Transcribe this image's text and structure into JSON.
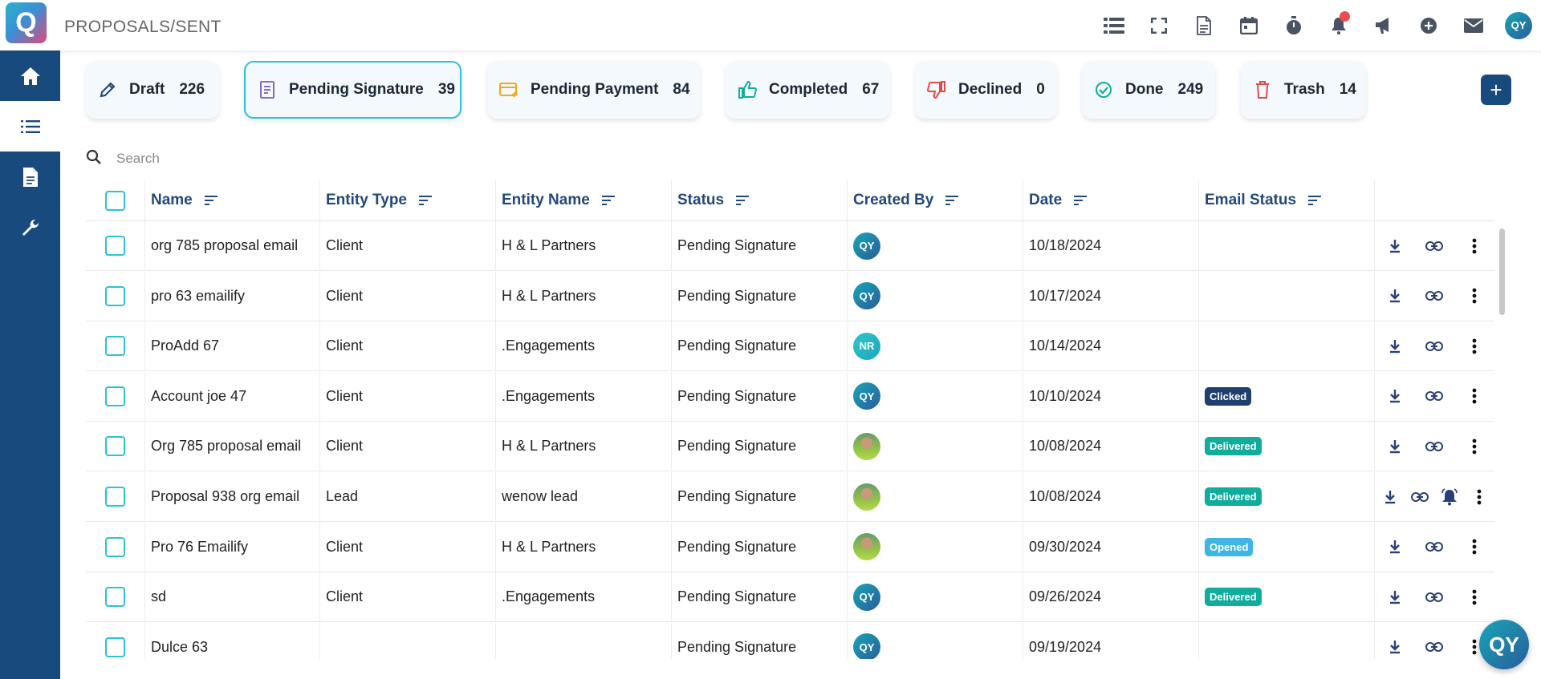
{
  "app": {
    "logo_letter": "Q",
    "page_title": "PROPOSALS/SENT"
  },
  "topbar": {
    "icons": [
      "list-view-icon",
      "fullscreen-icon",
      "document-icon",
      "calendar-icon",
      "timer-icon",
      "bell-icon",
      "megaphone-icon",
      "add-circle-icon",
      "mail-icon"
    ],
    "user_initials": "QY"
  },
  "sidebar": {
    "items": [
      {
        "name": "home",
        "icon": "home-icon",
        "active": false
      },
      {
        "name": "list",
        "icon": "list-icon",
        "active": true
      },
      {
        "name": "document",
        "icon": "document-icon",
        "active": false
      },
      {
        "name": "tools",
        "icon": "wrench-icon",
        "active": false
      }
    ]
  },
  "tabs": [
    {
      "label": "Draft",
      "count": "226",
      "icon": "pencil-icon",
      "color": "#1f3f6e"
    },
    {
      "label": "Pending Signature",
      "count": "39",
      "icon": "document-icon",
      "color": "#7b5bbd",
      "active": true
    },
    {
      "label": "Pending Payment",
      "count": "84",
      "icon": "credit-card-icon",
      "color": "#f2a81d"
    },
    {
      "label": "Completed",
      "count": "67",
      "icon": "thumbs-up-icon",
      "color": "#11ad9c"
    },
    {
      "label": "Declined",
      "count": "0",
      "icon": "thumbs-down-icon",
      "color": "#e24a4a"
    },
    {
      "label": "Done",
      "count": "249",
      "icon": "check-circle-icon",
      "color": "#11ad9c"
    },
    {
      "label": "Trash",
      "count": "14",
      "icon": "trash-icon",
      "color": "#e24a4a"
    }
  ],
  "add_button_label": "+",
  "search": {
    "placeholder": "Search"
  },
  "table": {
    "headers": [
      "Name",
      "Entity Type",
      "Entity Name",
      "Status",
      "Created By",
      "Date",
      "Email Status"
    ],
    "rows": [
      {
        "name": "org 785 proposal email",
        "entity_type": "Client",
        "entity_name": "H & L Partners",
        "status": "Pending Signature",
        "created_by": "QY",
        "avatar": "initials",
        "date": "10/18/2024",
        "email_status": "",
        "bell": false
      },
      {
        "name": "pro 63 emailify",
        "entity_type": "Client",
        "entity_name": "H & L Partners",
        "status": "Pending Signature",
        "created_by": "QY",
        "avatar": "initials",
        "date": "10/17/2024",
        "email_status": "",
        "bell": false
      },
      {
        "name": "ProAdd 67",
        "entity_type": "Client",
        "entity_name": ".Engagements",
        "status": "Pending Signature",
        "created_by": "NR",
        "avatar": "nr",
        "date": "10/14/2024",
        "email_status": "",
        "bell": false
      },
      {
        "name": "Account joe 47",
        "entity_type": "Client",
        "entity_name": ".Engagements",
        "status": "Pending Signature",
        "created_by": "QY",
        "avatar": "initials",
        "date": "10/10/2024",
        "email_status": "Clicked",
        "bell": false
      },
      {
        "name": "Org 785 proposal email",
        "entity_type": "Client",
        "entity_name": "H & L Partners",
        "status": "Pending Signature",
        "created_by": "",
        "avatar": "photo",
        "date": "10/08/2024",
        "email_status": "Delivered",
        "bell": false
      },
      {
        "name": "Proposal 938 org email",
        "entity_type": "Lead",
        "entity_name": "wenow lead",
        "status": "Pending Signature",
        "created_by": "",
        "avatar": "photo",
        "date": "10/08/2024",
        "email_status": "Delivered",
        "bell": true
      },
      {
        "name": "Pro 76 Emailify",
        "entity_type": "Client",
        "entity_name": "H & L Partners",
        "status": "Pending Signature",
        "created_by": "",
        "avatar": "photo",
        "date": "09/30/2024",
        "email_status": "Opened",
        "bell": false
      },
      {
        "name": "sd",
        "entity_type": "Client",
        "entity_name": ".Engagements",
        "status": "Pending Signature",
        "created_by": "QY",
        "avatar": "initials",
        "date": "09/26/2024",
        "email_status": "Delivered",
        "bell": false
      },
      {
        "name": "Dulce 63",
        "entity_type": "",
        "entity_name": "",
        "status": "Pending Signature",
        "created_by": "QY",
        "avatar": "initials",
        "date": "09/19/2024",
        "email_status": "",
        "bell": false
      }
    ]
  },
  "fab_initials": "QY"
}
